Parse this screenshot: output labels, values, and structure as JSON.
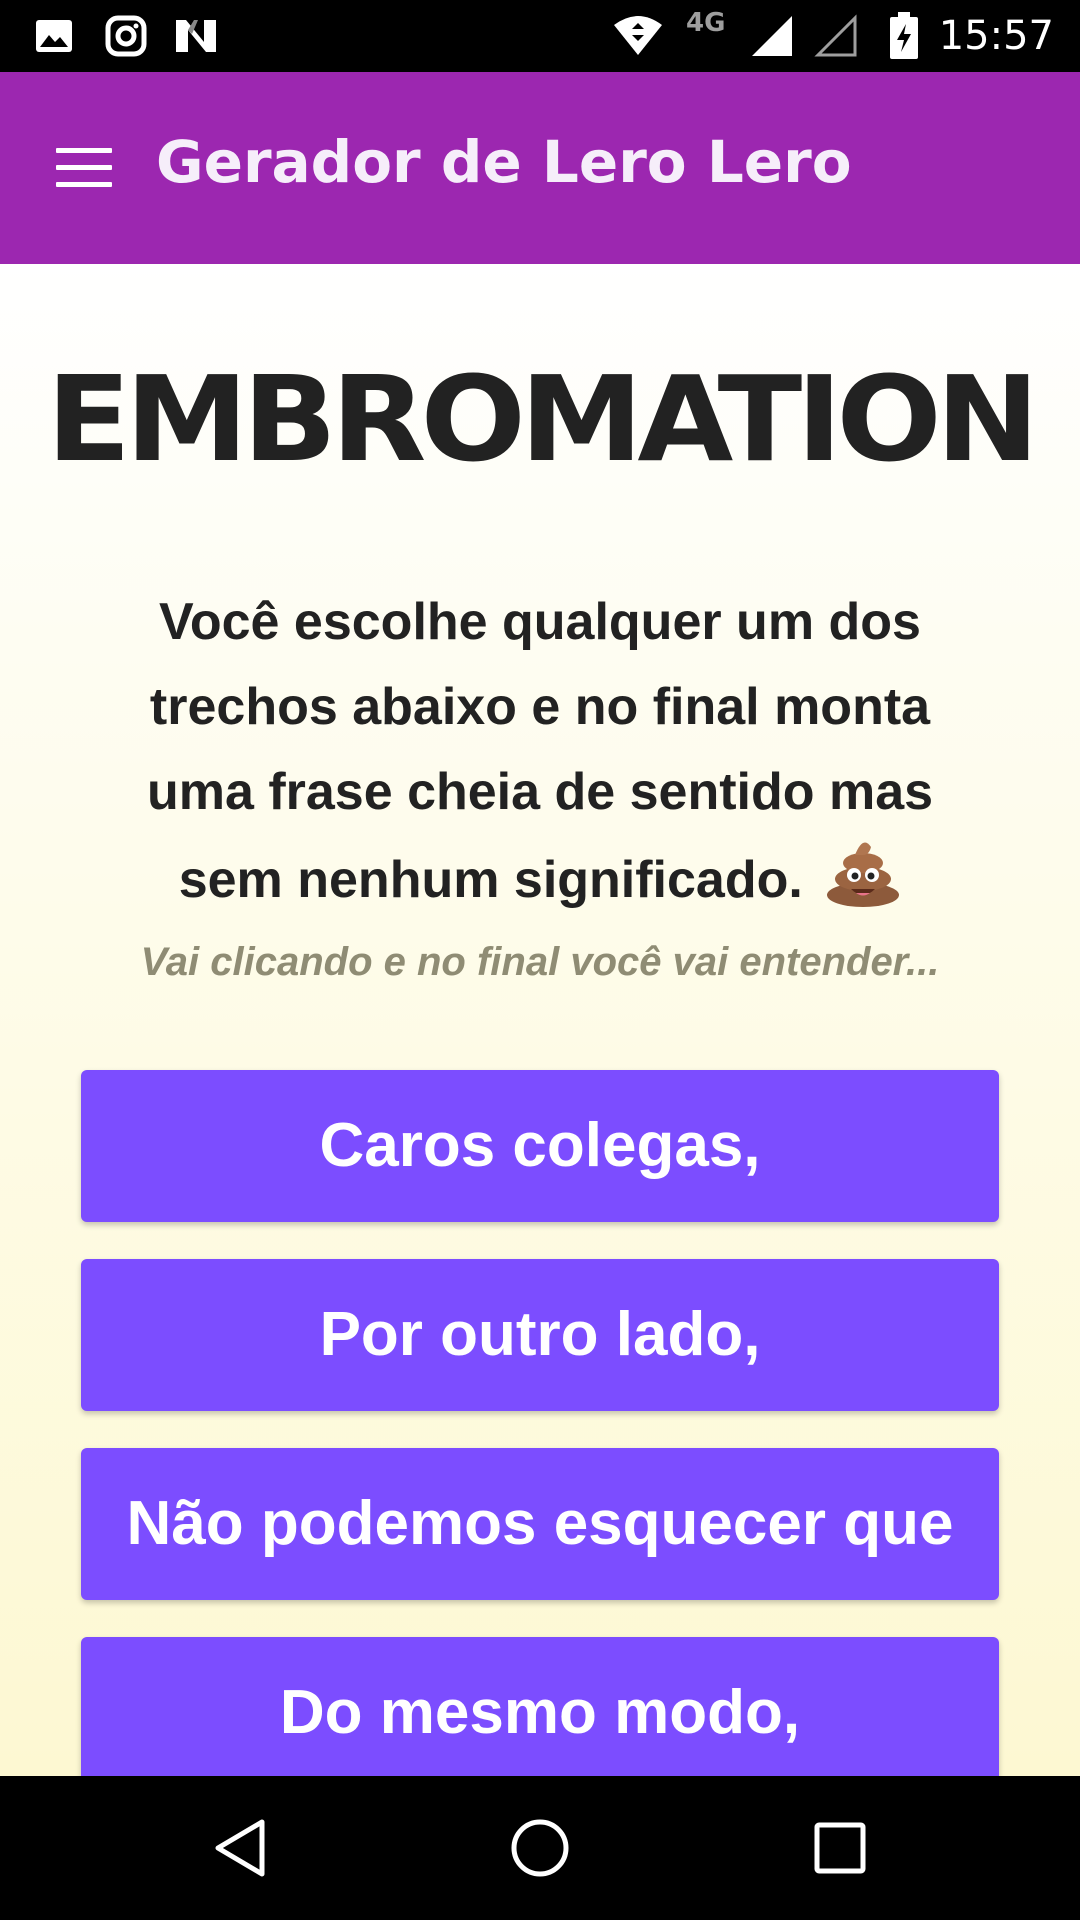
{
  "status_bar": {
    "time": "15:57",
    "network_label": "4G",
    "icons": [
      "gallery-icon",
      "instagram-icon",
      "n-app-icon",
      "wifi-icon",
      "signal-icon",
      "signal-empty-icon",
      "battery-charging-icon"
    ]
  },
  "app_bar": {
    "title": "Gerador de Lero Lero",
    "menu_icon": "hamburger-menu-icon",
    "color": "#9c27b0"
  },
  "main": {
    "logo_text": "EMBROMATION",
    "description": "Você escolhe qualquer um dos trechos abaixo e no final monta uma frase cheia de sentido mas sem nenhum significado.",
    "description_emoji": "pile-of-poo-icon",
    "subtitle": "Vai clicando e no final você vai entender...",
    "choices": [
      {
        "label": "Caros colegas,"
      },
      {
        "label": "Por outro lado,"
      },
      {
        "label": "Não podemos esquecer que"
      },
      {
        "label": "Do mesmo modo,"
      }
    ],
    "button_color": "#7c4dff"
  },
  "nav_bar": {
    "buttons": [
      "back-icon",
      "home-icon",
      "recents-icon"
    ]
  }
}
